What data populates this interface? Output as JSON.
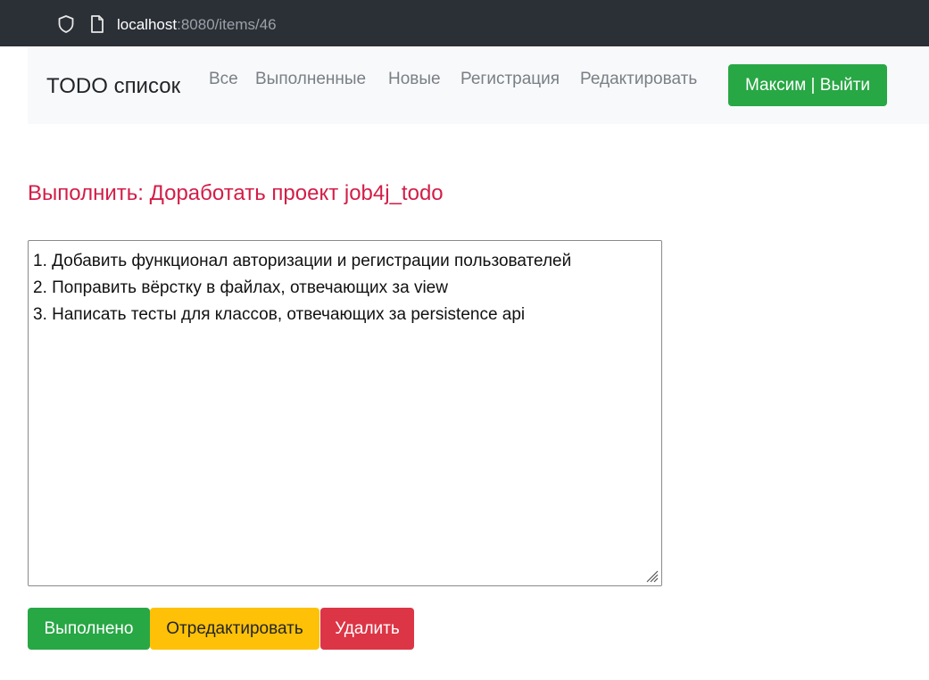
{
  "browser": {
    "url_host": "localhost",
    "url_path": ":8080/items/46"
  },
  "navbar": {
    "brand": "TODO список",
    "links": [
      "Все",
      "Выполненные",
      "Новые",
      "Регистрация",
      "Редактировать"
    ],
    "user_button": "Максим | Выйти"
  },
  "item": {
    "heading": "Выполнить: Доработать проект job4j_todo",
    "description_lines": [
      "1. Добавить функционал авторизации и регистрации пользователей",
      "2. Поправить вёрстку в файлах, отвечающих за view",
      "3. Написать тесты для классов, отвечающих за persistence api"
    ]
  },
  "actions": {
    "done_label": "Выполнено",
    "edit_label": "Отредактировать",
    "delete_label": "Удалить"
  },
  "colors": {
    "success": "#28a745",
    "warning": "#ffc107",
    "danger": "#dc3545",
    "heading": "#d31d47",
    "navbar_bg": "#f8f9fa",
    "browser_bg": "#2b2f36"
  },
  "icons": {
    "address_bar_left": "shield-icon",
    "address_bar_page": "page-icon"
  }
}
